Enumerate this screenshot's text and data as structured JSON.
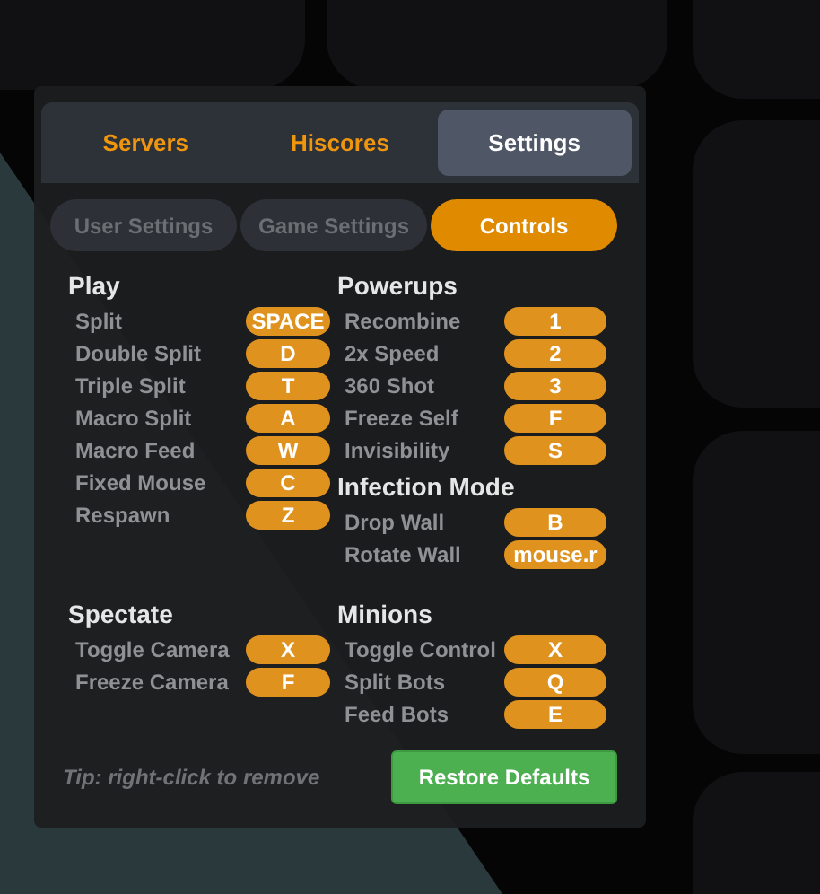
{
  "tabs": [
    {
      "label": "Servers",
      "selected": false
    },
    {
      "label": "Hiscores",
      "selected": false
    },
    {
      "label": "Settings",
      "selected": true
    }
  ],
  "subtabs": [
    {
      "label": "User Settings",
      "selected": false
    },
    {
      "label": "Game Settings",
      "selected": false
    },
    {
      "label": "Controls",
      "selected": true
    }
  ],
  "section_rows": [
    {
      "left": [
        {
          "title": "Play",
          "bindings": [
            {
              "action": "Split",
              "key": "SPACE"
            },
            {
              "action": "Double Split",
              "key": "D"
            },
            {
              "action": "Triple Split",
              "key": "T"
            },
            {
              "action": "Macro Split",
              "key": "A"
            },
            {
              "action": "Macro Feed",
              "key": "W"
            },
            {
              "action": "Fixed Mouse",
              "key": "C"
            },
            {
              "action": "Respawn",
              "key": "Z"
            }
          ]
        }
      ],
      "right": [
        {
          "title": "Powerups",
          "bindings": [
            {
              "action": "Recombine",
              "key": "1"
            },
            {
              "action": "2x Speed",
              "key": "2"
            },
            {
              "action": "360 Shot",
              "key": "3"
            },
            {
              "action": "Freeze Self",
              "key": "F"
            },
            {
              "action": "Invisibility",
              "key": "S"
            }
          ]
        },
        {
          "title": "Infection Mode",
          "bindings": [
            {
              "action": "Drop Wall",
              "key": "B"
            },
            {
              "action": "Rotate Wall",
              "key": "mouse.r"
            }
          ]
        }
      ]
    },
    {
      "left": [
        {
          "title": "Spectate",
          "bindings": [
            {
              "action": "Toggle Camera",
              "key": "X"
            },
            {
              "action": "Freeze Camera",
              "key": "F"
            }
          ]
        }
      ],
      "right": [
        {
          "title": "Minions",
          "bindings": [
            {
              "action": "Toggle Control",
              "key": "X"
            },
            {
              "action": "Split Bots",
              "key": "Q"
            },
            {
              "action": "Feed Bots",
              "key": "E"
            }
          ]
        }
      ]
    }
  ],
  "tip": "Tip: right-click to remove",
  "restore_button": "Restore Defaults"
}
